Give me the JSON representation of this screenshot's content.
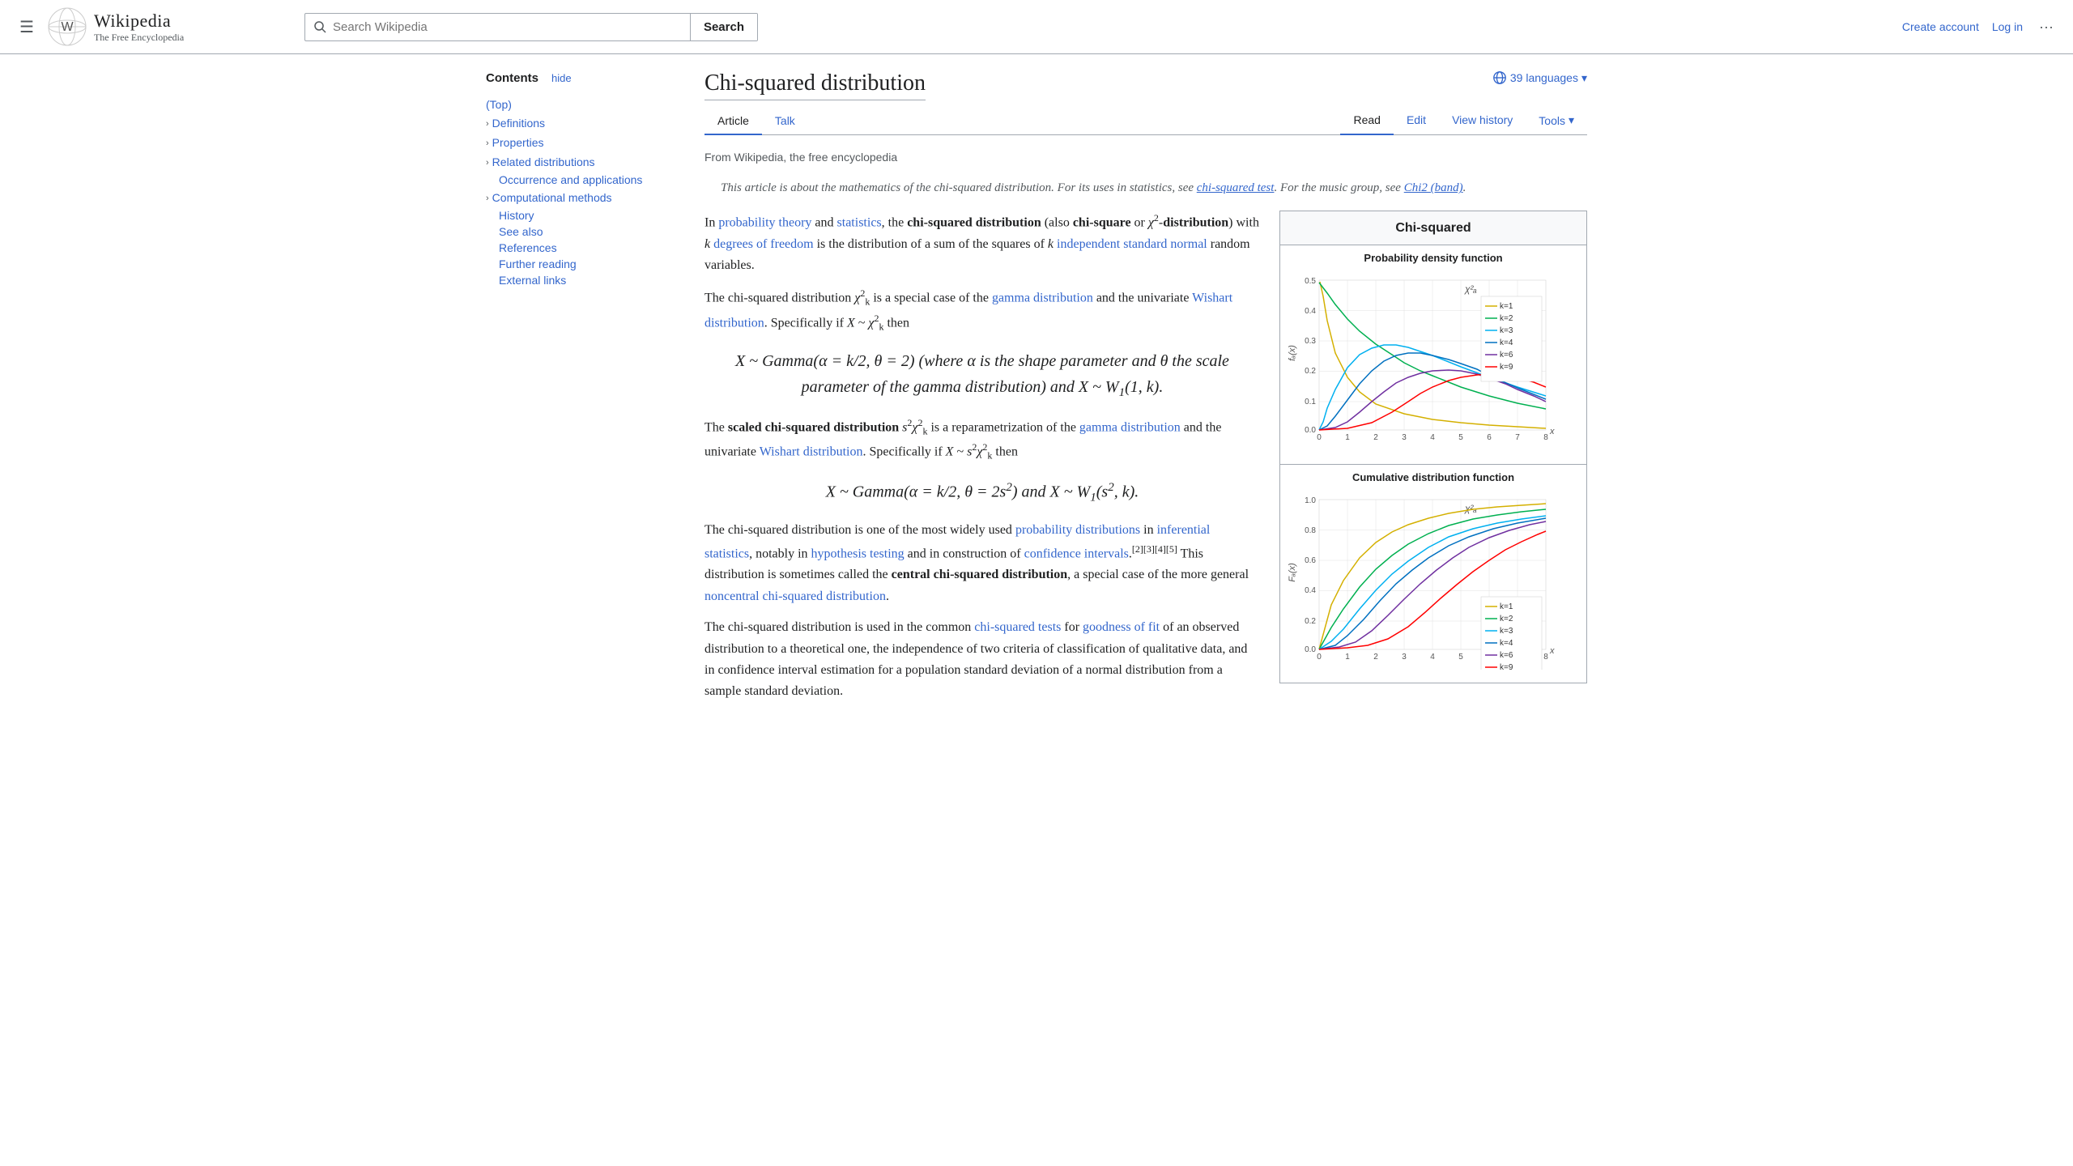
{
  "header": {
    "hamburger_label": "☰",
    "logo_title": "Wikipedia",
    "logo_subtitle": "The Free Encyclopedia",
    "search_placeholder": "Search Wikipedia",
    "search_button_label": "Search",
    "create_account_label": "Create account",
    "login_label": "Log in",
    "more_label": "···"
  },
  "toc": {
    "title": "Contents",
    "hide_label": "hide",
    "items": [
      {
        "id": "top",
        "label": "(Top)",
        "indent": 0,
        "expandable": false
      },
      {
        "id": "definitions",
        "label": "Definitions",
        "indent": 0,
        "expandable": true
      },
      {
        "id": "properties",
        "label": "Properties",
        "indent": 0,
        "expandable": true
      },
      {
        "id": "related",
        "label": "Related distributions",
        "indent": 0,
        "expandable": true
      },
      {
        "id": "occurrence",
        "label": "Occurrence and applications",
        "indent": 1,
        "expandable": false
      },
      {
        "id": "computational",
        "label": "Computational methods",
        "indent": 0,
        "expandable": true
      },
      {
        "id": "history",
        "label": "History",
        "indent": 1,
        "expandable": false
      },
      {
        "id": "see_also",
        "label": "See also",
        "indent": 1,
        "expandable": false
      },
      {
        "id": "references",
        "label": "References",
        "indent": 1,
        "expandable": false
      },
      {
        "id": "further",
        "label": "Further reading",
        "indent": 1,
        "expandable": false
      },
      {
        "id": "external",
        "label": "External links",
        "indent": 1,
        "expandable": false
      }
    ]
  },
  "article": {
    "title": "Chi-squared distribution",
    "lang_count": "39 languages",
    "from_wiki": "From Wikipedia, the free encyclopedia",
    "tabs": [
      "Article",
      "Talk"
    ],
    "tabs_right": [
      "Read",
      "Edit",
      "View history",
      "Tools"
    ],
    "active_tab": "Article",
    "active_right_tab": "Read",
    "hatnote": "This article is about the mathematics of the chi-squared distribution. For its uses in statistics, see chi-squared test. For the music group, see Chi2 (band).",
    "hatnote_link1_text": "chi-squared test",
    "hatnote_link2_text": "Chi2 (band)",
    "infobox_title": "Chi-squared",
    "chart1_title": "Probability density function",
    "chart1_ylabel": "fₖ(x)",
    "chart1_xlabel": "x",
    "chart1_formula": "χ²ₖ",
    "chart2_title": "Cumulative distribution function",
    "chart2_ylabel": "Fₖ(x)",
    "chart2_xlabel": "x",
    "chart2_formula": "χ²ₖ",
    "legend": [
      {
        "k": "k=1",
        "color": "#d4b000"
      },
      {
        "k": "k=2",
        "color": "#00b050"
      },
      {
        "k": "k=3",
        "color": "#00b0f0"
      },
      {
        "k": "k=4",
        "color": "#0070c0"
      },
      {
        "k": "k=6",
        "color": "#7030a0"
      },
      {
        "k": "k=9",
        "color": "#ff0000"
      }
    ],
    "paragraphs": [
      "In probability theory and statistics, the chi-squared distribution (also chi-square or χ²-distribution) with k degrees of freedom is the distribution of a sum of the squares of k independent standard normal random variables.",
      "The chi-squared distribution χ²k is a special case of the gamma distribution and the univariate Wishart distribution. Specifically if X ~ χ²k then",
      "X ~ Gamma(α = k/2, θ = 2) (where α is the shape parameter and θ the scale parameter of the gamma distribution) and X ~ W₁(1, k).",
      "The scaled chi-squared distribution s²χ²k is a reparametrization of the gamma distribution and the univariate Wishart distribution. Specifically if X ~ s²χ²k then",
      "X ~ Gamma(α = k/2, θ = 2s²) and X ~ W₁(s², k).",
      "The chi-squared distribution is one of the most widely used probability distributions in inferential statistics, notably in hypothesis testing and in construction of confidence intervals.[2][3][4][5] This distribution is sometimes called the central chi-squared distribution, a special case of the more general noncentral chi-squared distribution.",
      "The chi-squared distribution is used in the common chi-squared tests for goodness of fit of an observed distribution to a theoretical one, the independence of two criteria of classification of qualitative data, and in confidence interval estimation for a population standard deviation of a normal distribution from a sample standard deviation."
    ]
  }
}
